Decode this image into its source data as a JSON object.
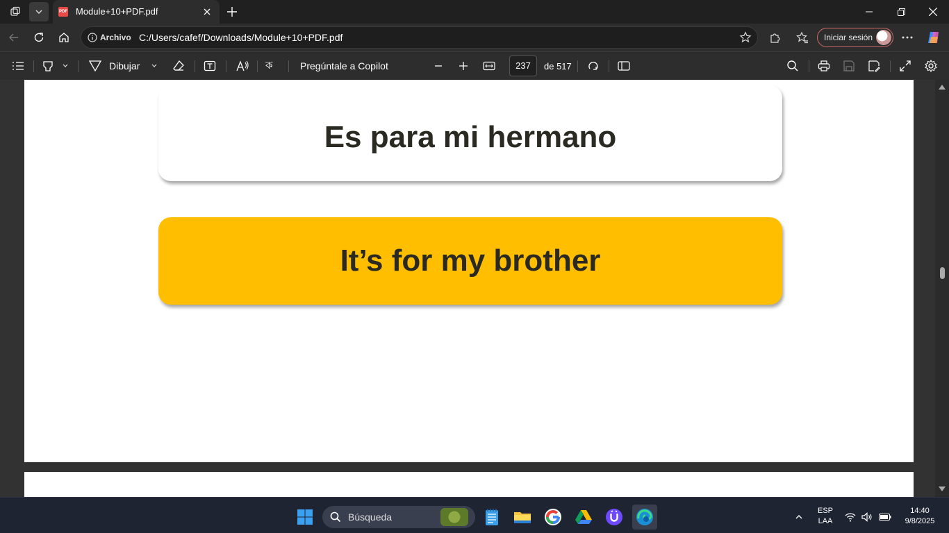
{
  "browser": {
    "tab_title": "Module+10+PDF.pdf",
    "address_label": "Archivo",
    "url": "C:/Users/cafef/Downloads/Module+10+PDF.pdf",
    "signin_label": "Iniciar sesión"
  },
  "pdf_toolbar": {
    "draw_label": "Dibujar",
    "copilot_label": "Pregúntale a Copilot",
    "current_page": "237",
    "page_of": "de 517"
  },
  "document": {
    "spanish_phrase": "Es para mi hermano",
    "english_phrase": "It’s for my brother",
    "highlight_color": "#ffbf00"
  },
  "taskbar": {
    "search_placeholder": "Búsqueda",
    "language": "ESP",
    "language_sub": "LAA",
    "time": "14:40",
    "date": "9/8/2025"
  }
}
